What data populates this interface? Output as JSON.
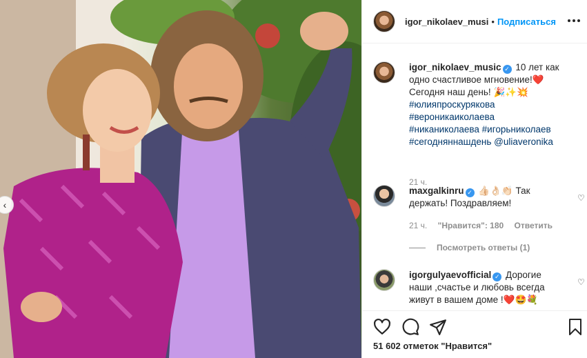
{
  "post": {
    "author": "igor_nikolaev_musi",
    "separator": "•",
    "follow_label": "Подписаться",
    "more_label": "•••"
  },
  "caption": {
    "username": "igor_nikolaev_music",
    "verified": "✓",
    "text_1": " 10 лет как одно счастливое мгновение!",
    "emoji_heart": "❤️",
    "text_2": " Сегодня наш день!",
    "emoji_party": "🎉✨💥",
    "hashtags": [
      "#юлияпроскурякова",
      "#вероникаиколаева",
      "#никаниколаева",
      "#игорьниколаев",
      "#сегодняннашдень"
    ],
    "mention": "@uliaveronika",
    "time": "21 ч."
  },
  "comments": [
    {
      "username": "maxgalkinru",
      "verified": "✓",
      "emoji": "👍🏻👌🏻👏🏻",
      "text": " Так держать! Поздравляем!",
      "time": "21 ч.",
      "likes": "\"Нравится\": 180",
      "reply": "Ответить",
      "view_replies": "Посмотреть ответы (1)"
    },
    {
      "username": "igorgulyaevofficial",
      "verified": "✓",
      "text": " Дорогие наши ,счастье и любовь всегда живут в вашем доме !",
      "emoji": "❤️🤩💐"
    }
  ],
  "footer": {
    "likes_count": "51 602 отметок \"Нравится\""
  },
  "icons": {
    "heart": "♡",
    "prev": "‹"
  },
  "colors": {
    "link_blue": "#0095f6",
    "hashtag": "#00376b",
    "verified": "#3897f0",
    "muted": "#8e8e8e",
    "border": "#efefef"
  }
}
